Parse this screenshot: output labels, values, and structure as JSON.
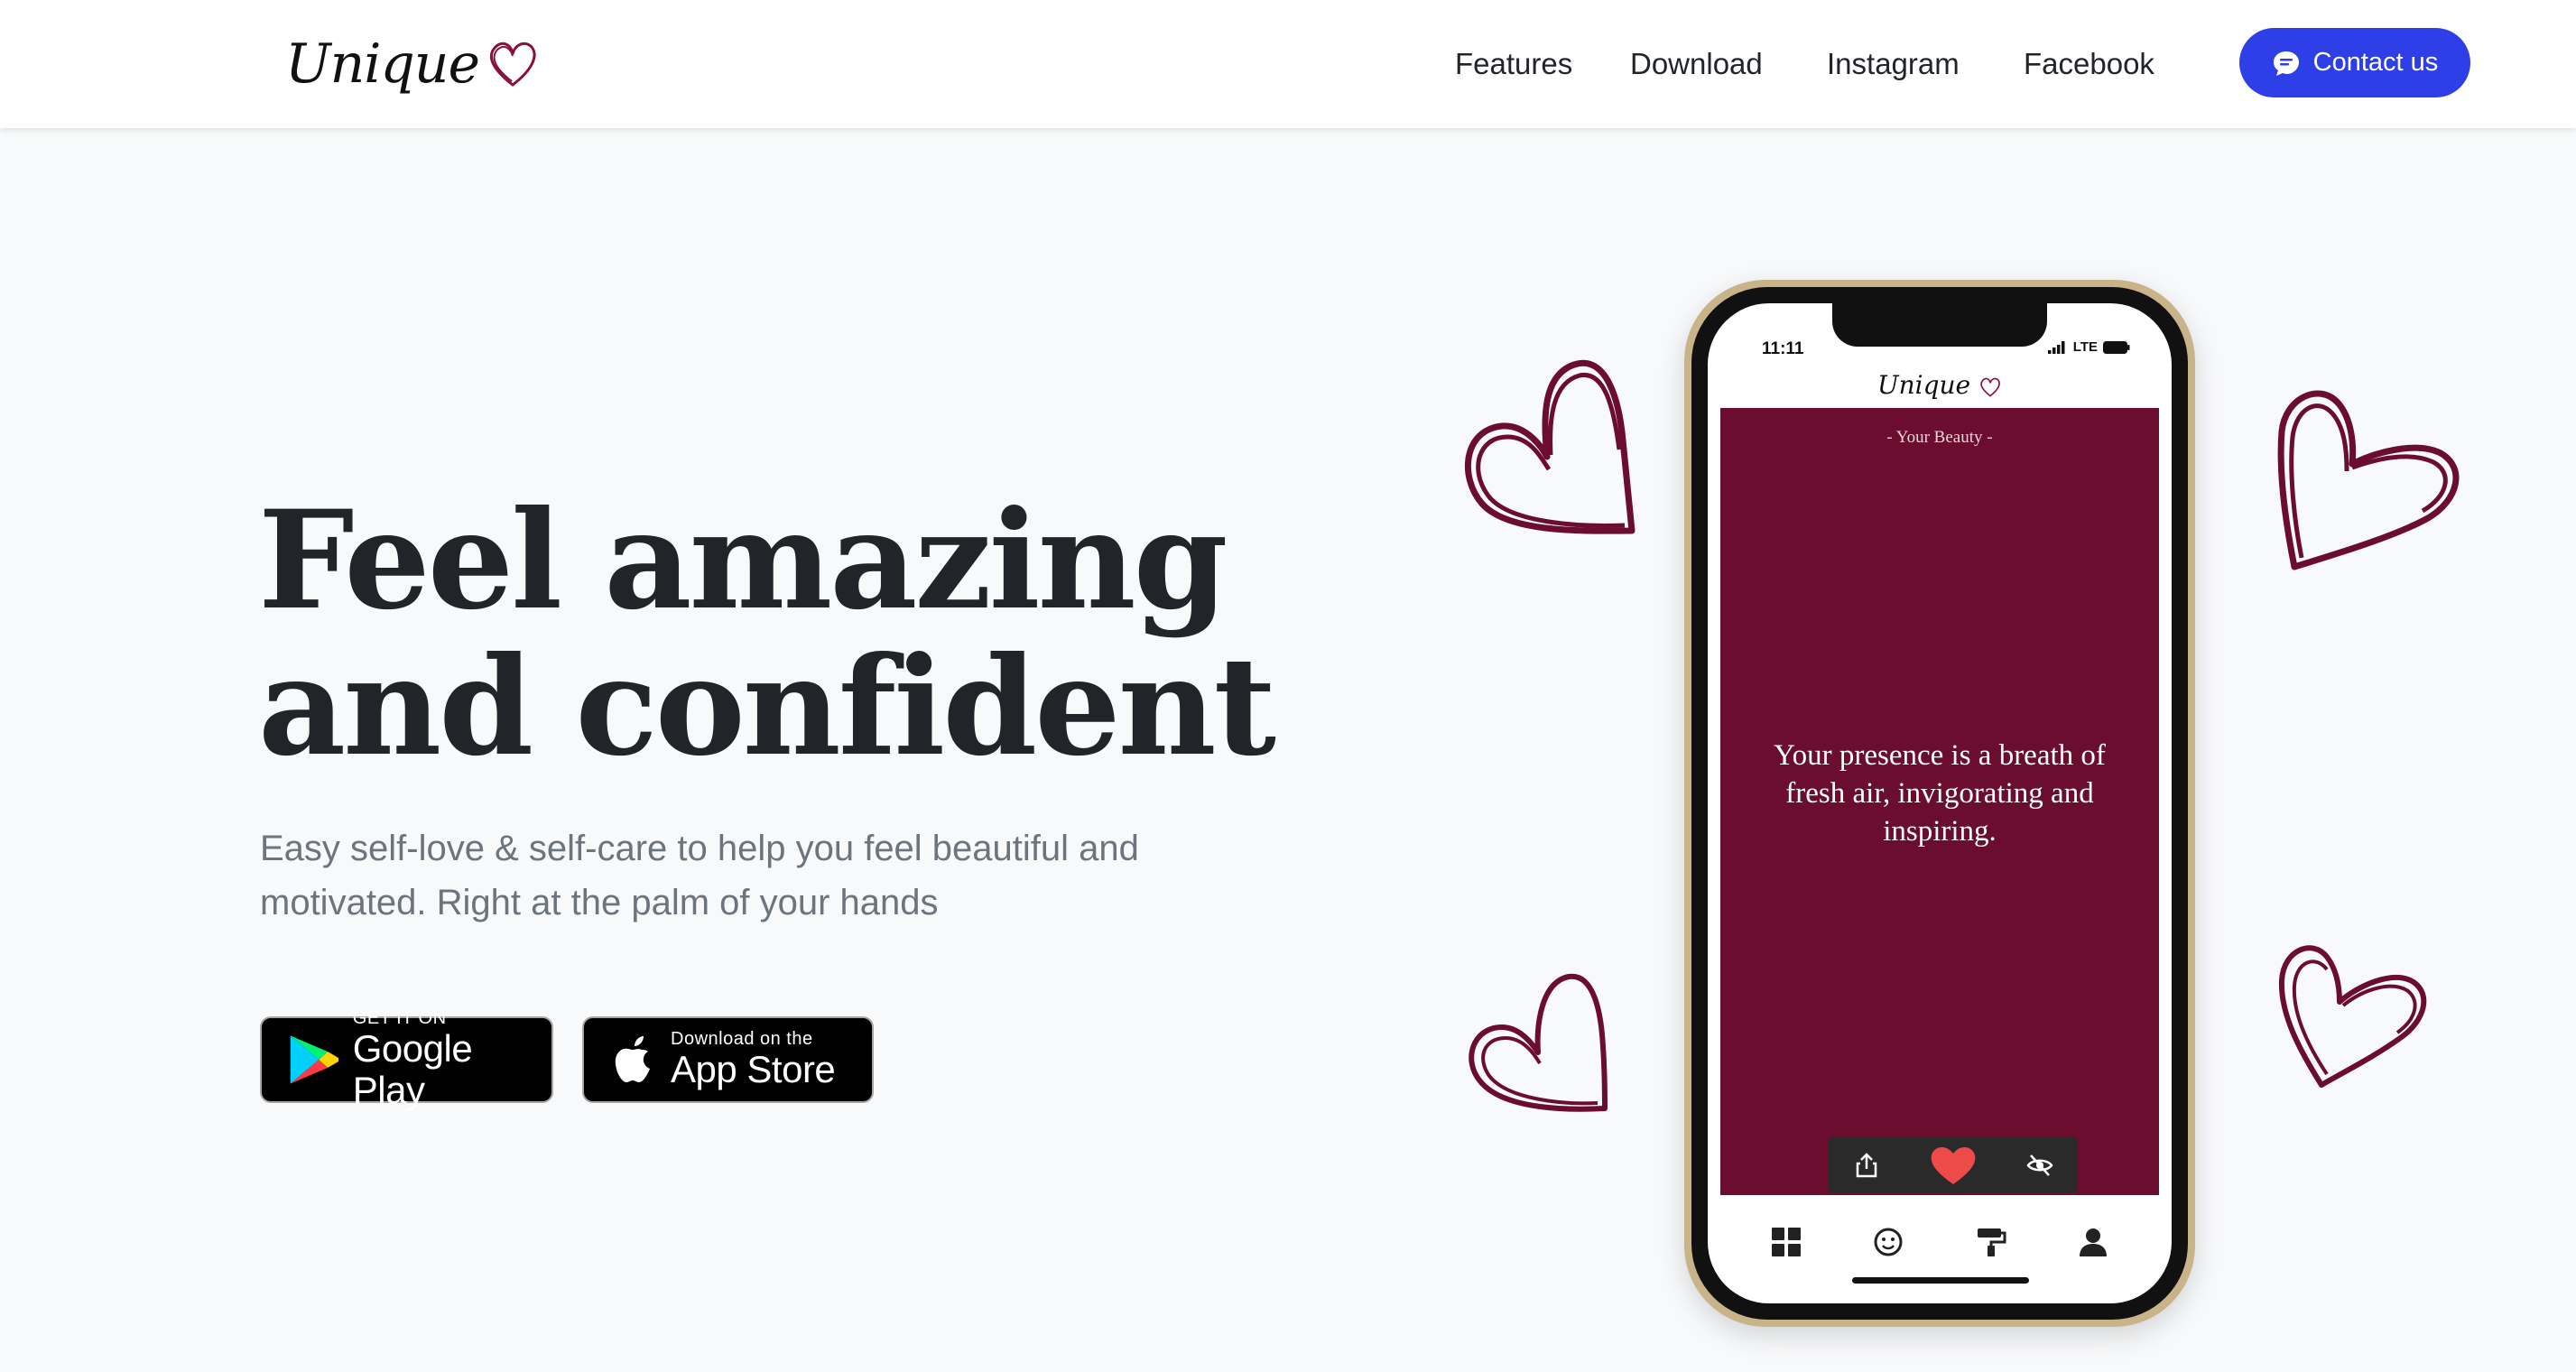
{
  "navbar": {
    "brand": "Unique",
    "links": [
      "Features",
      "Download",
      "Instagram",
      "Facebook"
    ],
    "contact_label": "Contact us"
  },
  "hero": {
    "title_line1": "Feel amazing",
    "title_line2": "and confident",
    "subtitle": "Easy self-love & self-care to help you feel beautiful and motivated. Right at the palm of your hands"
  },
  "stores": {
    "google": {
      "small": "GET IT ON",
      "big": "Google Play"
    },
    "apple": {
      "small": "Download on the",
      "big": "App Store"
    }
  },
  "phone": {
    "status_time": "11:11",
    "status_network": "LTE",
    "app_brand": "Unique",
    "card_label": "- Your Beauty -",
    "quote": "Your presence is a breath of fresh air, invigorating and inspiring.",
    "card_color": "#6b0d2e"
  },
  "colors": {
    "accent": "#2f3fe8",
    "heart": "#6b0d2e"
  }
}
